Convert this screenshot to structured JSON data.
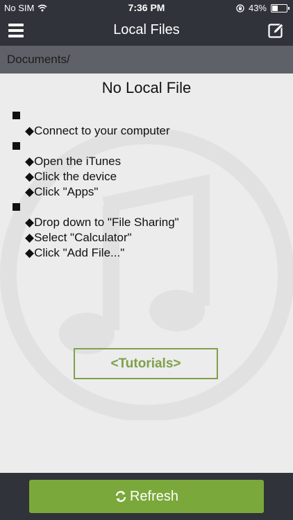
{
  "status_bar": {
    "carrier": "No SIM",
    "time": "7:36 PM",
    "battery_percent": "43%",
    "battery_level": 0.43,
    "icons": [
      "wifi-icon",
      "orientation-lock-icon",
      "battery-icon"
    ]
  },
  "nav": {
    "title": "Local Files",
    "left_icon": "menu-icon",
    "right_icon": "edit-icon"
  },
  "path": "Documents/",
  "main": {
    "heading": "No Local File",
    "step_groups": [
      {
        "steps": [
          "◆Connect to your computer"
        ]
      },
      {
        "steps": [
          "◆Open the iTunes",
          "◆Click the device",
          "◆Click \"Apps\""
        ]
      },
      {
        "steps": [
          "◆Drop down to \"File Sharing\"",
          "◆Select \"Calculator\"",
          "◆Click \"Add File...\""
        ]
      }
    ],
    "tutorials_label": "<Tutorials>"
  },
  "bottom": {
    "refresh_label": "Refresh",
    "refresh_icon": "refresh-icon"
  },
  "colors": {
    "header": "#30333a",
    "path_bar": "#5f6168",
    "background": "#ececec",
    "accent_green": "#7aa83a",
    "outline_green": "#7ea04a"
  }
}
